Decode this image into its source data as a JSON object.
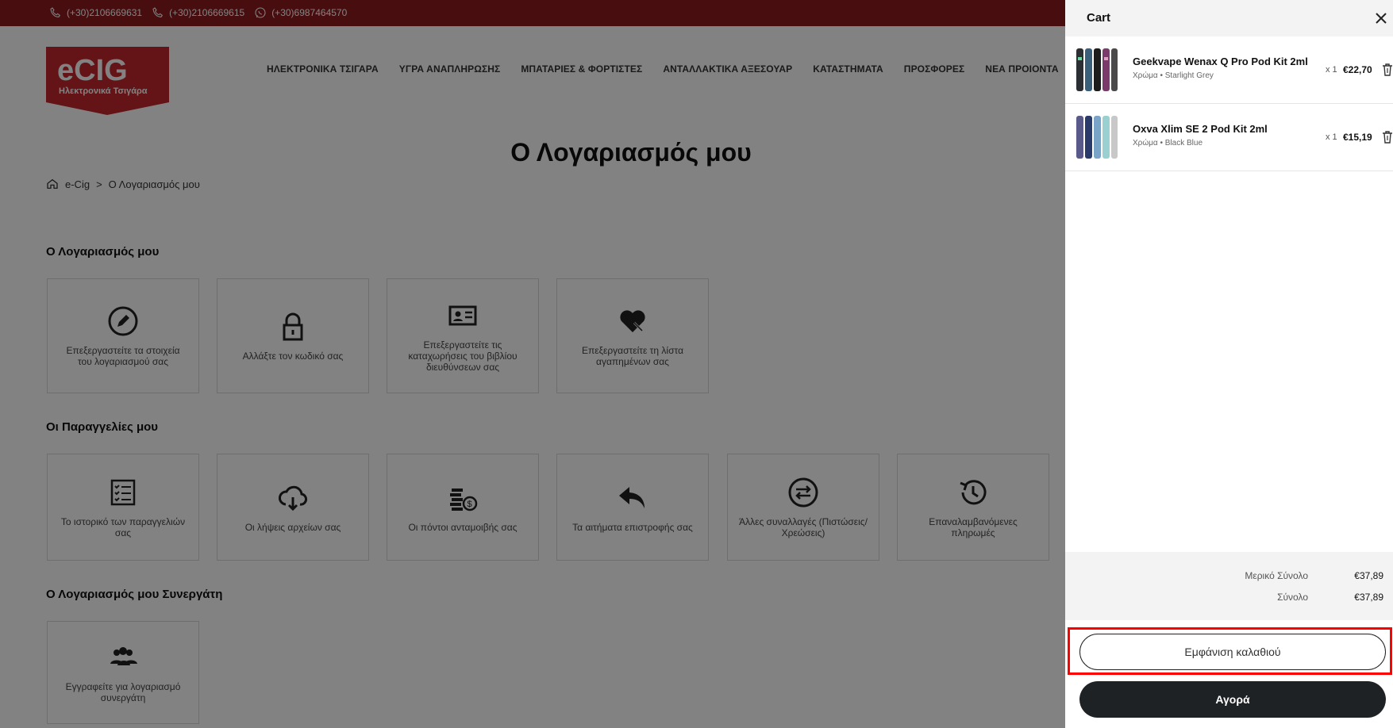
{
  "topbar": {
    "phones": [
      "(+30)2106669631",
      "(+30)2106669615",
      "(+30)6987464570"
    ]
  },
  "logo": {
    "brand": "eCIG",
    "tagline": "Ηλεκτρονικά Τσιγάρα"
  },
  "nav": [
    "ΗΛΕΚΤΡΟΝΙΚΑ ΤΣΙΓΑΡΑ",
    "ΥΓΡΑ ΑΝΑΠΛΗΡΩΣΗΣ",
    "ΜΠΑΤΑΡΙΕΣ & ΦΟΡΤΙΣΤΕΣ",
    "ΑΝΤΑΛΛΑΚΤΙΚΑ ΑΞΕΣΟΥΑΡ",
    "ΚΑΤΑΣΤΗΜΑΤΑ",
    "ΠΡΟΣΦΟΡΕΣ",
    "ΝΕΑ ΠΡΟΙΟΝΤΑ"
  ],
  "page_title": "Ο Λογαριασμός μου",
  "breadcrumb": {
    "home": "e-Cig",
    "sep": ">",
    "current": "Ο Λογαριασμός μου"
  },
  "sections": {
    "account": {
      "title": "Ο Λογαριασμός μου",
      "cards": [
        "Επεξεργαστείτε τα στοιχεία του λογαριασμού σας",
        "Αλλάξτε τον κωδικό σας",
        "Επεξεργαστείτε τις καταχωρήσεις του βιβλίου διευθύνσεων σας",
        "Επεξεργαστείτε τη λίστα αγαπημένων σας"
      ]
    },
    "orders": {
      "title": "Οι Παραγγελίες μου",
      "cards": [
        "Το ιστορικό των παραγγελιών σας",
        "Οι λήψεις αρχείων σας",
        "Οι πόντοι ανταμοιβής σας",
        "Τα αιτήματα επιστροφής σας",
        "Άλλες συναλλαγές (Πιστώσεις/Χρεώσεις)",
        "Επαναλαμβανόμενες πληρωμές"
      ]
    },
    "affiliate": {
      "title": "Ο Λογαριασμός μου Συνεργάτη",
      "cards": [
        "Εγγραφείτε για λογαριασμό συνεργάτη"
      ]
    }
  },
  "cart": {
    "title": "Cart",
    "items": [
      {
        "name": "Geekvape Wenax Q Pro Pod Kit 2ml",
        "variant": "Χρώμα • Starlight Grey",
        "qty": "x 1",
        "price": "€22,70"
      },
      {
        "name": "Oxva Xlim SE 2 Pod Kit 2ml",
        "variant": "Χρώμα • Black Blue",
        "qty": "x 1",
        "price": "€15,19"
      }
    ],
    "subtotal_label": "Μερικό Σύνολο",
    "subtotal_value": "€37,89",
    "total_label": "Σύνολο",
    "total_value": "€37,89",
    "view_cart": "Εμφάνιση καλαθιού",
    "checkout": "Αγορά"
  },
  "colors": {
    "topbar": "#8b1a1f",
    "logo_red": "#c4262e",
    "highlight": "#ff0000",
    "buy_button": "#1e2224"
  }
}
